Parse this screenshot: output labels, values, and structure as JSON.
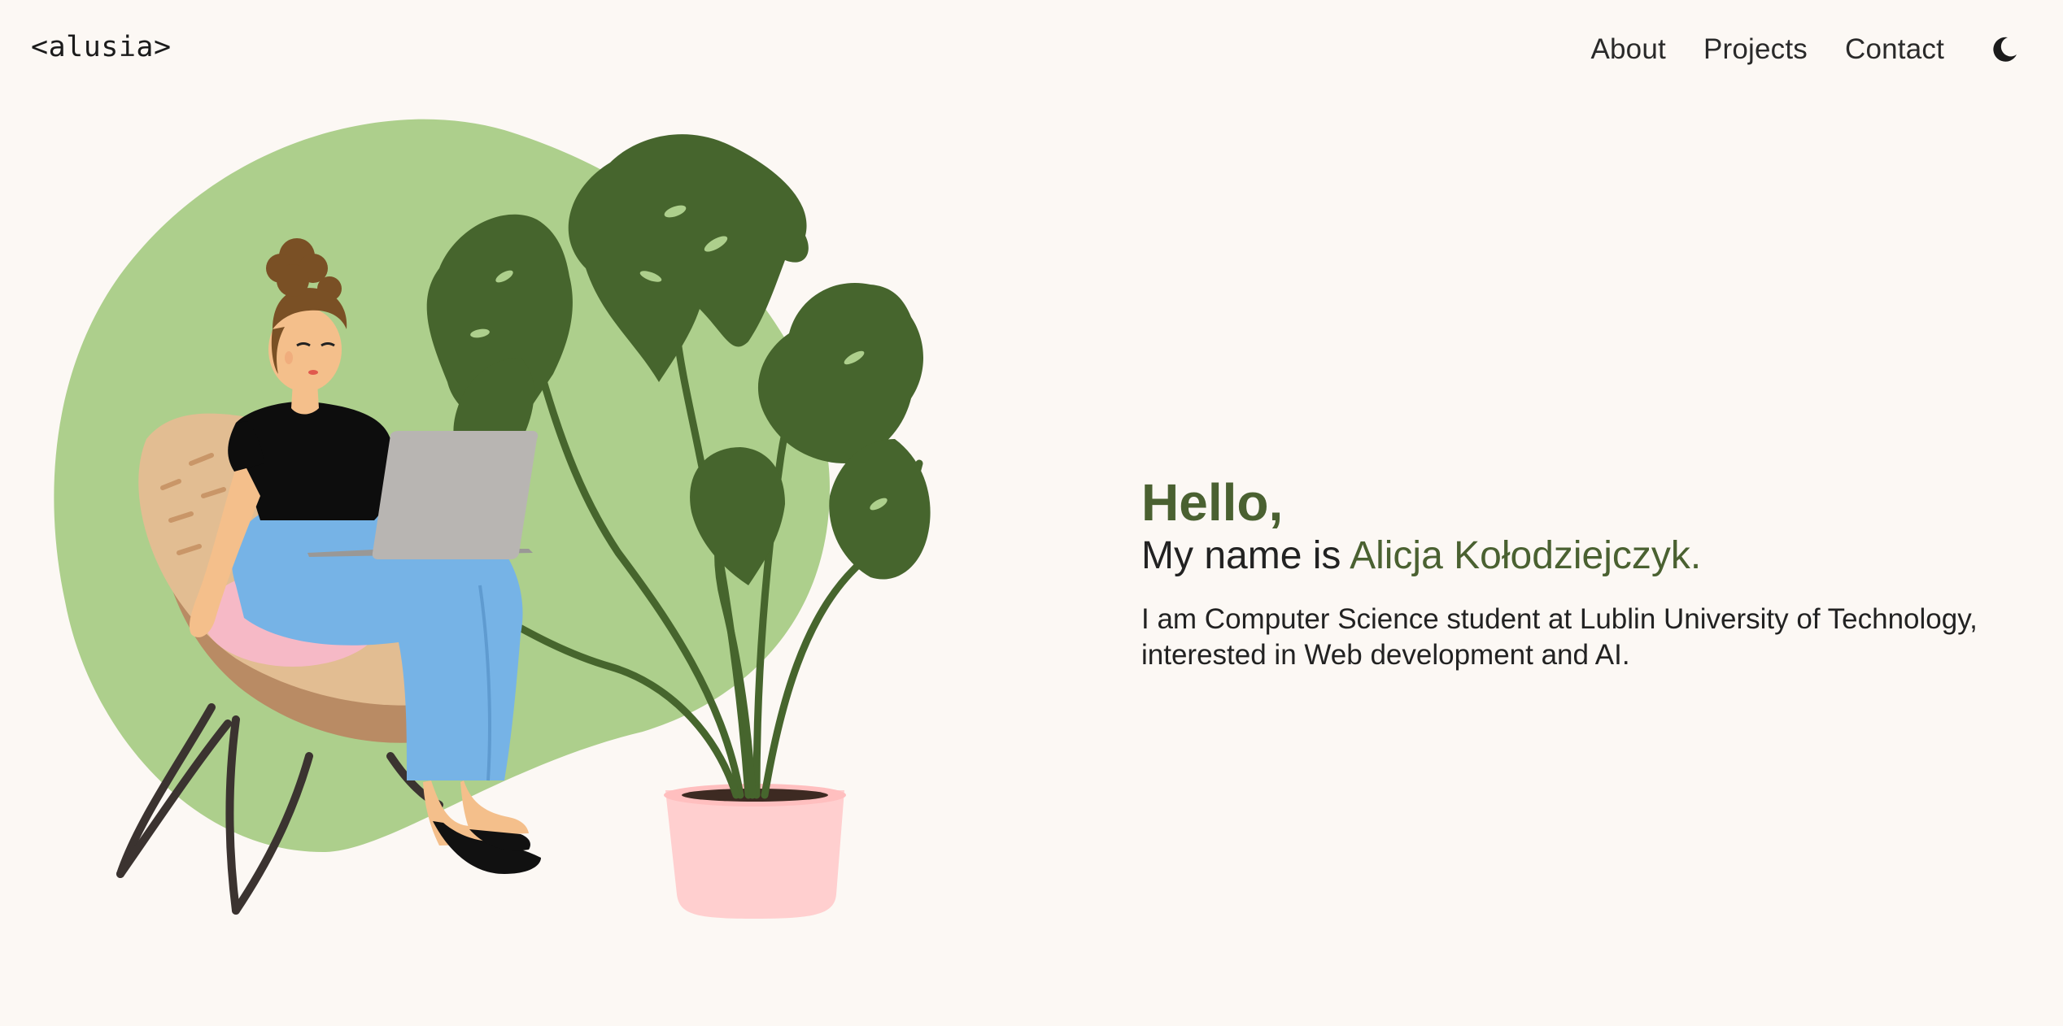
{
  "header": {
    "logo": "<alusia>",
    "nav": {
      "about": "About",
      "projects": "Projects",
      "contact": "Contact"
    },
    "theme_toggle_icon": "moon-icon"
  },
  "hero": {
    "greeting": "Hello,",
    "name_prefix": "My name is ",
    "name": "Alicja Kołodziejczyk.",
    "description_line1": "I am Computer Science student at Lublin University of Technology,",
    "description_line2": "interested in Web development and AI."
  },
  "colors": {
    "background": "#fcf8f4",
    "accent_green": "#4a6131",
    "blob_green": "#adcf8c",
    "leaf_green": "#46652d",
    "pot_pink": "#ffcfcf",
    "jeans_blue": "#76b3e6"
  }
}
